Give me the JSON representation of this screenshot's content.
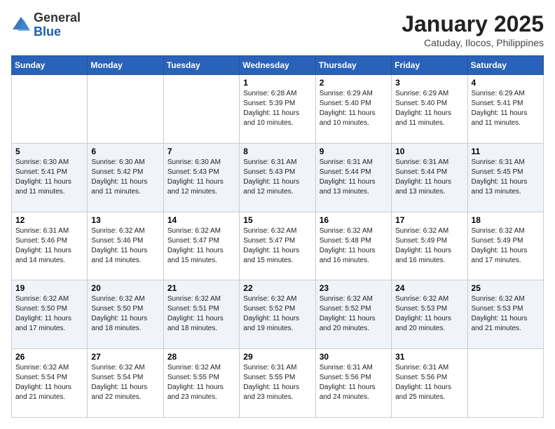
{
  "header": {
    "logo_general": "General",
    "logo_blue": "Blue",
    "month_title": "January 2025",
    "location": "Catuday, Ilocos, Philippines"
  },
  "days_of_week": [
    "Sunday",
    "Monday",
    "Tuesday",
    "Wednesday",
    "Thursday",
    "Friday",
    "Saturday"
  ],
  "weeks": [
    [
      {
        "day": "",
        "info": ""
      },
      {
        "day": "",
        "info": ""
      },
      {
        "day": "",
        "info": ""
      },
      {
        "day": "1",
        "info": "Sunrise: 6:28 AM\nSunset: 5:39 PM\nDaylight: 11 hours and 10 minutes."
      },
      {
        "day": "2",
        "info": "Sunrise: 6:29 AM\nSunset: 5:40 PM\nDaylight: 11 hours and 10 minutes."
      },
      {
        "day": "3",
        "info": "Sunrise: 6:29 AM\nSunset: 5:40 PM\nDaylight: 11 hours and 11 minutes."
      },
      {
        "day": "4",
        "info": "Sunrise: 6:29 AM\nSunset: 5:41 PM\nDaylight: 11 hours and 11 minutes."
      }
    ],
    [
      {
        "day": "5",
        "info": "Sunrise: 6:30 AM\nSunset: 5:41 PM\nDaylight: 11 hours and 11 minutes."
      },
      {
        "day": "6",
        "info": "Sunrise: 6:30 AM\nSunset: 5:42 PM\nDaylight: 11 hours and 11 minutes."
      },
      {
        "day": "7",
        "info": "Sunrise: 6:30 AM\nSunset: 5:43 PM\nDaylight: 11 hours and 12 minutes."
      },
      {
        "day": "8",
        "info": "Sunrise: 6:31 AM\nSunset: 5:43 PM\nDaylight: 11 hours and 12 minutes."
      },
      {
        "day": "9",
        "info": "Sunrise: 6:31 AM\nSunset: 5:44 PM\nDaylight: 11 hours and 13 minutes."
      },
      {
        "day": "10",
        "info": "Sunrise: 6:31 AM\nSunset: 5:44 PM\nDaylight: 11 hours and 13 minutes."
      },
      {
        "day": "11",
        "info": "Sunrise: 6:31 AM\nSunset: 5:45 PM\nDaylight: 11 hours and 13 minutes."
      }
    ],
    [
      {
        "day": "12",
        "info": "Sunrise: 6:31 AM\nSunset: 5:46 PM\nDaylight: 11 hours and 14 minutes."
      },
      {
        "day": "13",
        "info": "Sunrise: 6:32 AM\nSunset: 5:46 PM\nDaylight: 11 hours and 14 minutes."
      },
      {
        "day": "14",
        "info": "Sunrise: 6:32 AM\nSunset: 5:47 PM\nDaylight: 11 hours and 15 minutes."
      },
      {
        "day": "15",
        "info": "Sunrise: 6:32 AM\nSunset: 5:47 PM\nDaylight: 11 hours and 15 minutes."
      },
      {
        "day": "16",
        "info": "Sunrise: 6:32 AM\nSunset: 5:48 PM\nDaylight: 11 hours and 16 minutes."
      },
      {
        "day": "17",
        "info": "Sunrise: 6:32 AM\nSunset: 5:49 PM\nDaylight: 11 hours and 16 minutes."
      },
      {
        "day": "18",
        "info": "Sunrise: 6:32 AM\nSunset: 5:49 PM\nDaylight: 11 hours and 17 minutes."
      }
    ],
    [
      {
        "day": "19",
        "info": "Sunrise: 6:32 AM\nSunset: 5:50 PM\nDaylight: 11 hours and 17 minutes."
      },
      {
        "day": "20",
        "info": "Sunrise: 6:32 AM\nSunset: 5:50 PM\nDaylight: 11 hours and 18 minutes."
      },
      {
        "day": "21",
        "info": "Sunrise: 6:32 AM\nSunset: 5:51 PM\nDaylight: 11 hours and 18 minutes."
      },
      {
        "day": "22",
        "info": "Sunrise: 6:32 AM\nSunset: 5:52 PM\nDaylight: 11 hours and 19 minutes."
      },
      {
        "day": "23",
        "info": "Sunrise: 6:32 AM\nSunset: 5:52 PM\nDaylight: 11 hours and 20 minutes."
      },
      {
        "day": "24",
        "info": "Sunrise: 6:32 AM\nSunset: 5:53 PM\nDaylight: 11 hours and 20 minutes."
      },
      {
        "day": "25",
        "info": "Sunrise: 6:32 AM\nSunset: 5:53 PM\nDaylight: 11 hours and 21 minutes."
      }
    ],
    [
      {
        "day": "26",
        "info": "Sunrise: 6:32 AM\nSunset: 5:54 PM\nDaylight: 11 hours and 21 minutes."
      },
      {
        "day": "27",
        "info": "Sunrise: 6:32 AM\nSunset: 5:54 PM\nDaylight: 11 hours and 22 minutes."
      },
      {
        "day": "28",
        "info": "Sunrise: 6:32 AM\nSunset: 5:55 PM\nDaylight: 11 hours and 23 minutes."
      },
      {
        "day": "29",
        "info": "Sunrise: 6:31 AM\nSunset: 5:55 PM\nDaylight: 11 hours and 23 minutes."
      },
      {
        "day": "30",
        "info": "Sunrise: 6:31 AM\nSunset: 5:56 PM\nDaylight: 11 hours and 24 minutes."
      },
      {
        "day": "31",
        "info": "Sunrise: 6:31 AM\nSunset: 5:56 PM\nDaylight: 11 hours and 25 minutes."
      },
      {
        "day": "",
        "info": ""
      }
    ]
  ]
}
